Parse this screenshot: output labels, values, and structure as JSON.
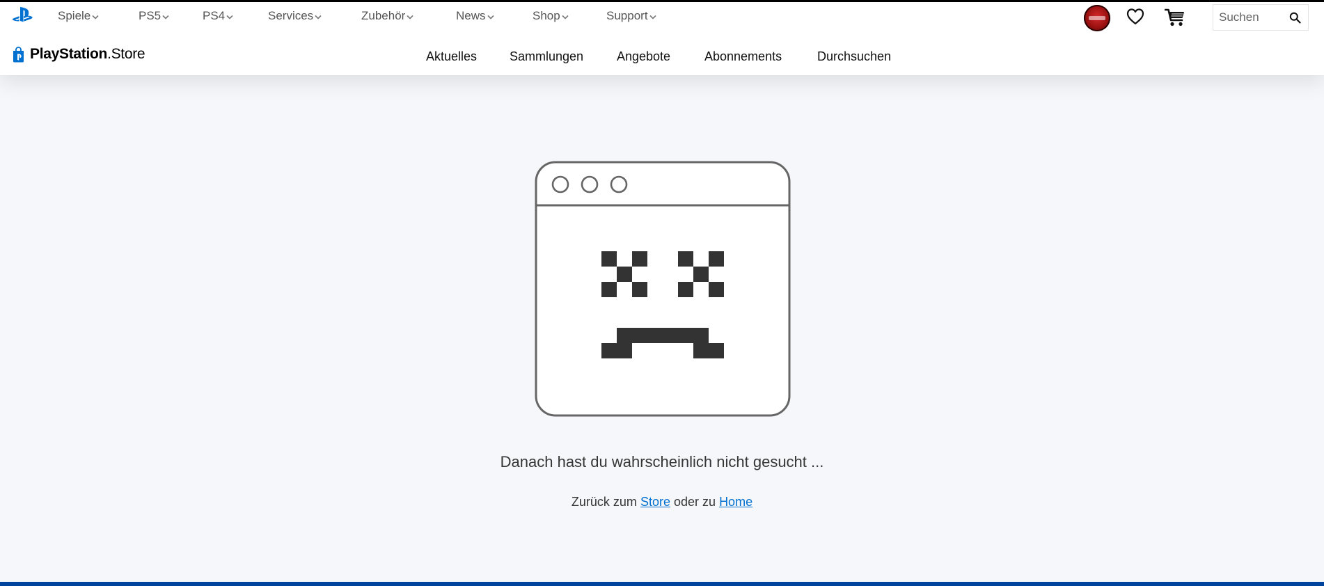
{
  "global_nav": {
    "items": [
      {
        "label": "Spiele"
      },
      {
        "label": "PS5"
      },
      {
        "label": "PS4"
      },
      {
        "label": "Services"
      },
      {
        "label": "Zubehör"
      },
      {
        "label": "News"
      },
      {
        "label": "Shop"
      },
      {
        "label": "Support"
      }
    ],
    "search_placeholder": "Suchen"
  },
  "store": {
    "brand_bold": "PlayStation",
    "brand_light": ".Store",
    "nav": [
      {
        "label": "Aktuelles"
      },
      {
        "label": "Sammlungen"
      },
      {
        "label": "Angebote"
      },
      {
        "label": "Abonnements"
      },
      {
        "label": "Durchsuchen"
      }
    ]
  },
  "error": {
    "title": "Danach hast du wahrscheinlich nicht gesucht ...",
    "prefix": "Zurück zum",
    "store_link": "Store",
    "middle": "oder zu",
    "home_link": "Home"
  },
  "colors": {
    "brand_blue": "#0070d1",
    "footer_blue": "#00439c",
    "illustration_stroke": "#666666",
    "illustration_fill": "#333333"
  },
  "icons": [
    "playstation-logo-icon",
    "chevron-down-icon",
    "heart-icon",
    "cart-icon",
    "search-icon",
    "store-bag-icon"
  ]
}
